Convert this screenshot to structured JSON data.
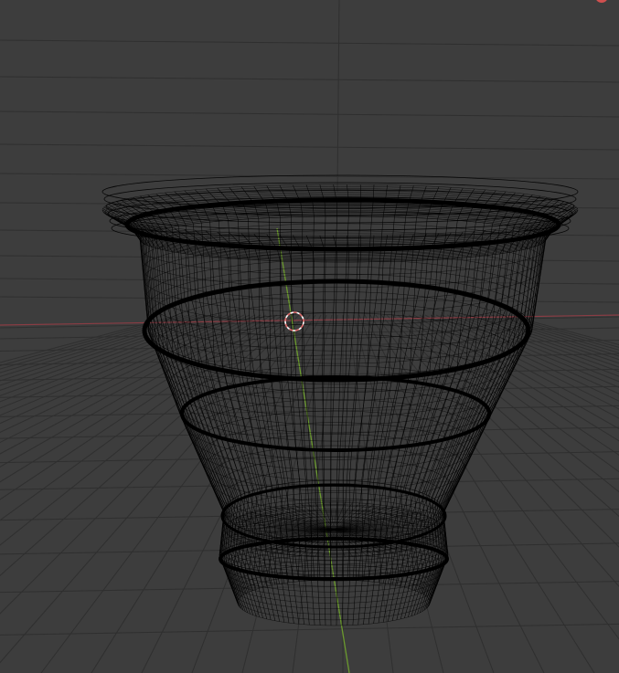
{
  "viewport": {
    "shading_mode": "wireframe",
    "object_name": "bucket",
    "colors": {
      "background": "#3d3d3d",
      "grid": "#2f2f2f",
      "grid_minor": "#353535",
      "x_axis": "#8a3d44",
      "y_axis": "#6b9a2e",
      "wireframe": "#000000",
      "cursor_red": "#e06a6a",
      "cursor_white": "#ffffff",
      "gizmo_x": "#d0504f"
    },
    "icons": {
      "cursor": "3d-cursor-icon",
      "gizmo": "axis-gizmo-icon"
    }
  }
}
